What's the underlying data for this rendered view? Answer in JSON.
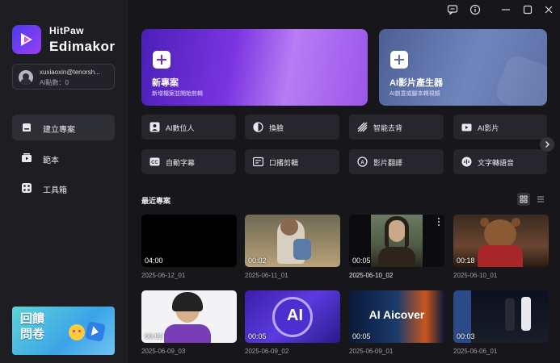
{
  "titlebar": {
    "icons": [
      "feedback-icon",
      "info-icon",
      "minimize-icon",
      "maximize-icon",
      "close-icon"
    ]
  },
  "sidebar": {
    "brand_small": "HitPaw",
    "brand_big": "Edimakor",
    "user": {
      "email": "xuxiaoxin@tenorsh...",
      "points": "AI點數：0"
    },
    "items": [
      {
        "label": "建立專案",
        "icon": "create-project-icon",
        "active": true
      },
      {
        "label": "範本",
        "icon": "template-icon",
        "active": false
      },
      {
        "label": "工具箱",
        "icon": "toolbox-icon",
        "active": false
      }
    ],
    "promo": {
      "text": "回饋問卷"
    }
  },
  "hero": [
    {
      "title": "新專案",
      "subtitle": "新增檔案並開始剪輯"
    },
    {
      "title": "AI影片產生器",
      "subtitle": "AI創意或腳本轉視頻"
    }
  ],
  "tools": [
    {
      "label": "AI數位人",
      "icon": "ai-avatar-icon"
    },
    {
      "label": "換臉",
      "icon": "face-swap-icon"
    },
    {
      "label": "智能去背",
      "icon": "remove-background-icon"
    },
    {
      "label": "AI影片",
      "icon": "ai-video-icon"
    },
    {
      "label": "自動字幕",
      "icon": "auto-subtitle-icon"
    },
    {
      "label": "口播剪輯",
      "icon": "voice-edit-icon"
    },
    {
      "label": "影片翻譯",
      "icon": "video-translate-icon"
    },
    {
      "label": "文字轉語音",
      "icon": "text-to-speech-icon"
    }
  ],
  "recent": {
    "title": "最近專案",
    "projects": [
      {
        "duration": "04:00",
        "date": "2025-06-12_01"
      },
      {
        "duration": "00:02",
        "date": "2025-06-11_01"
      },
      {
        "duration": "00:05",
        "date": "2025-06-10_02"
      },
      {
        "duration": "00:18",
        "date": "2025-06-10_01"
      },
      {
        "duration": "00:02",
        "date": "2025-06-09_03"
      },
      {
        "duration": "00:05",
        "date": "2025-06-09_02"
      },
      {
        "duration": "00:05",
        "date": "2025-06-09_01",
        "thumb_text": "AI Aicover"
      },
      {
        "duration": "00:03",
        "date": "2025-06-06_01"
      }
    ]
  },
  "colors": {
    "accent": "#7a34e0",
    "background": "#17171b",
    "sidebar": "#1d1d22",
    "tile": "#26262c"
  }
}
